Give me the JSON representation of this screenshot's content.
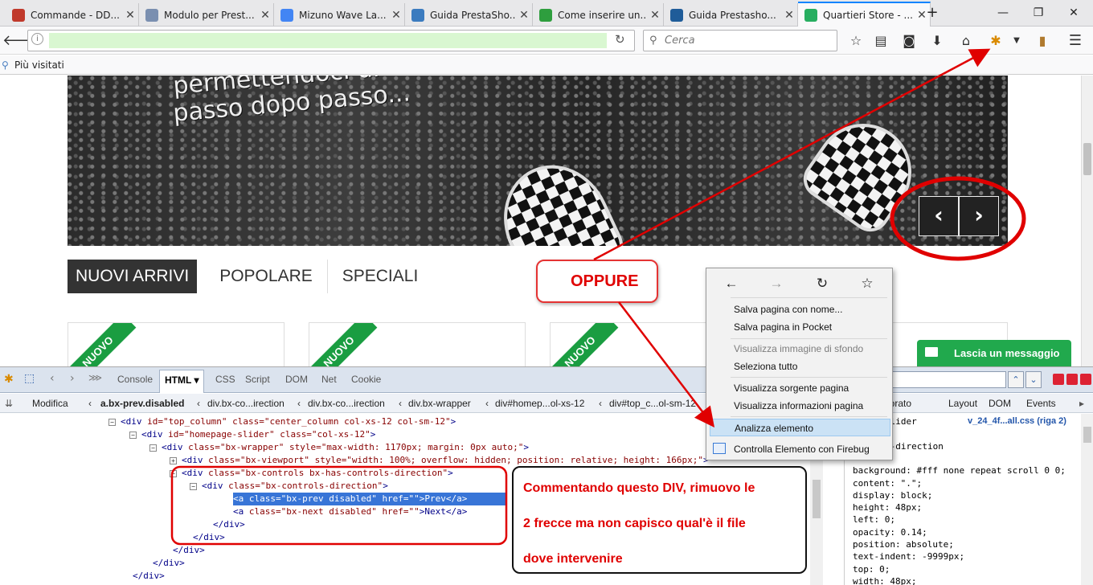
{
  "browser": {
    "tabs": [
      {
        "title": "Commande - DD...",
        "icon": "ladybug-icon",
        "color": "#c0392b"
      },
      {
        "title": "Modulo per Prest...",
        "icon": "puzzle-icon",
        "color": "#7a8fb0"
      },
      {
        "title": "Mizuno Wave La...",
        "icon": "google-icon",
        "color": "#4285f4"
      },
      {
        "title": "Guida PrestaSho...",
        "icon": "monitor-icon",
        "color": "#3b7bbf"
      },
      {
        "title": "Come inserire un...",
        "icon": "flag-icon",
        "color": "#2e9e3e"
      },
      {
        "title": "Guida Prestasho...",
        "icon": "wave-icon",
        "color": "#1f5c99"
      },
      {
        "title": "Quartieri Store - ...",
        "icon": "quartieri-icon",
        "color": "#27ae60"
      }
    ],
    "new_tab": "+",
    "window_controls": {
      "minimize": "—",
      "maximize": "❐",
      "close": "✕"
    },
    "search_placeholder": "Cerca",
    "bookmarks_label": "Più visitati"
  },
  "page": {
    "hero_line1": "permettendoci di",
    "hero_line2": "passo dopo passo...",
    "slider_prev": "‹",
    "slider_next": "›",
    "product_tabs": [
      "NUOVI ARRIVI",
      "POPOLARE",
      "SPECIALI"
    ],
    "ribbon": "NUOVO",
    "chat_button": "Lascia un messaggio"
  },
  "firebug": {
    "tabs": [
      "Console",
      "HTML ▾",
      "CSS",
      "Script",
      "DOM",
      "Net",
      "Cookie"
    ],
    "edit_label": "Modifica",
    "breadcrumbs": [
      "a.bx-prev.disabled",
      "div.bx-co...irection",
      "div.bx-co...irection",
      "div.bx-wrapper",
      "div#homep...ol-xs-12",
      "div#top_c...ol-sm-12"
    ],
    "side_tabs": [
      "borato",
      "Layout",
      "DOM",
      "Events"
    ],
    "html_lines": [
      {
        "indent": 150,
        "tw": "⊟",
        "tag_open": "<div ",
        "attrs": "id=\"top_column\" class=\"center_column col-xs-12 col-sm-12\"",
        "tail": ">"
      },
      {
        "indent": 176,
        "tw": "⊟",
        "tag_open": "<div ",
        "attrs": "id=\"homepage-slider\" class=\"col-xs-12\"",
        "tail": ">"
      },
      {
        "indent": 201,
        "tw": "⊟",
        "tag_open": "<div ",
        "attrs": "class=\"bx-wrapper\" style=\"max-width: 1170px; margin: 0px auto;\"",
        "tail": ">"
      },
      {
        "indent": 226,
        "tw": "⊞",
        "tag_open": "<div ",
        "attrs": "class=\"bx-viewport\" style=\"width: 100%; overflow: hidden; position: relative; height: 166px;\"",
        "tail": ">"
      },
      {
        "indent": 226,
        "tw": "⊟",
        "tag_open": "<div ",
        "attrs": "class=\"bx-controls bx-has-controls-direction\"",
        "tail": ">"
      },
      {
        "indent": 251,
        "tw": "⊟",
        "tag_open": "<div ",
        "attrs": "class=\"bx-controls-direction\"",
        "tail": ">"
      },
      {
        "indent": 290,
        "tw": "",
        "tag_open": "<a ",
        "attrs": "class=\"bx-prev disabled\" href=\"\"",
        "tail": ">Prev</a>",
        "selected": true
      },
      {
        "indent": 290,
        "tw": "",
        "tag_open": "<a ",
        "attrs": "class=\"bx-next disabled\" href=\"\"",
        "tail": ">Next</a>"
      },
      {
        "indent": 265,
        "tw": "",
        "tag_open": "</div",
        "attrs": "",
        "tail": ">"
      },
      {
        "indent": 240,
        "tw": "",
        "tag_open": "</div",
        "attrs": "",
        "tail": ">"
      },
      {
        "indent": 215,
        "tw": "",
        "tag_open": "</div",
        "attrs": "",
        "tail": ">"
      },
      {
        "indent": 190,
        "tw": "",
        "tag_open": "</div",
        "attrs": "",
        "tail": ">"
      },
      {
        "indent": 165,
        "tw": "",
        "tag_open": "</div",
        "attrs": "",
        "tail": ">"
      }
    ],
    "css_source": "v_24_4f...all.css (riga 2)",
    "css_lines": [
      "slider",
      "",
      "s-direction",
      "",
      "background: #fff none repeat scroll 0 0;",
      "content: \".\";",
      "display: block;",
      "height: 48px;",
      "left: 0;",
      "opacity: 0.14;",
      "position: absolute;",
      "text-indent: -9999px;",
      "top: 0;",
      "width: 48px;"
    ]
  },
  "context_menu": {
    "nav": [
      "←",
      "→",
      "↻",
      "☆"
    ],
    "items": [
      {
        "label": "Salva pagina con nome...",
        "dim": false
      },
      {
        "label": "Salva pagina in Pocket",
        "dim": false
      },
      {
        "label": "Visualizza immagine di sfondo",
        "dim": true
      },
      {
        "label": "Seleziona tutto",
        "dim": false
      },
      {
        "label": "Visualizza sorgente pagina",
        "dim": false
      },
      {
        "label": "Visualizza informazioni pagina",
        "dim": false
      },
      {
        "label": "Analizza elemento",
        "dim": false,
        "hover": true
      },
      {
        "label": "Controlla Elemento con Firebug",
        "dim": false
      }
    ]
  },
  "annotations": {
    "oppure": "OPPURE",
    "comment_lines": [
      "Commentando questo DIV, rimuovo le",
      "2 frecce ma non capisco qual'è il file",
      "dove intervenire"
    ],
    "color": "#e00000"
  }
}
